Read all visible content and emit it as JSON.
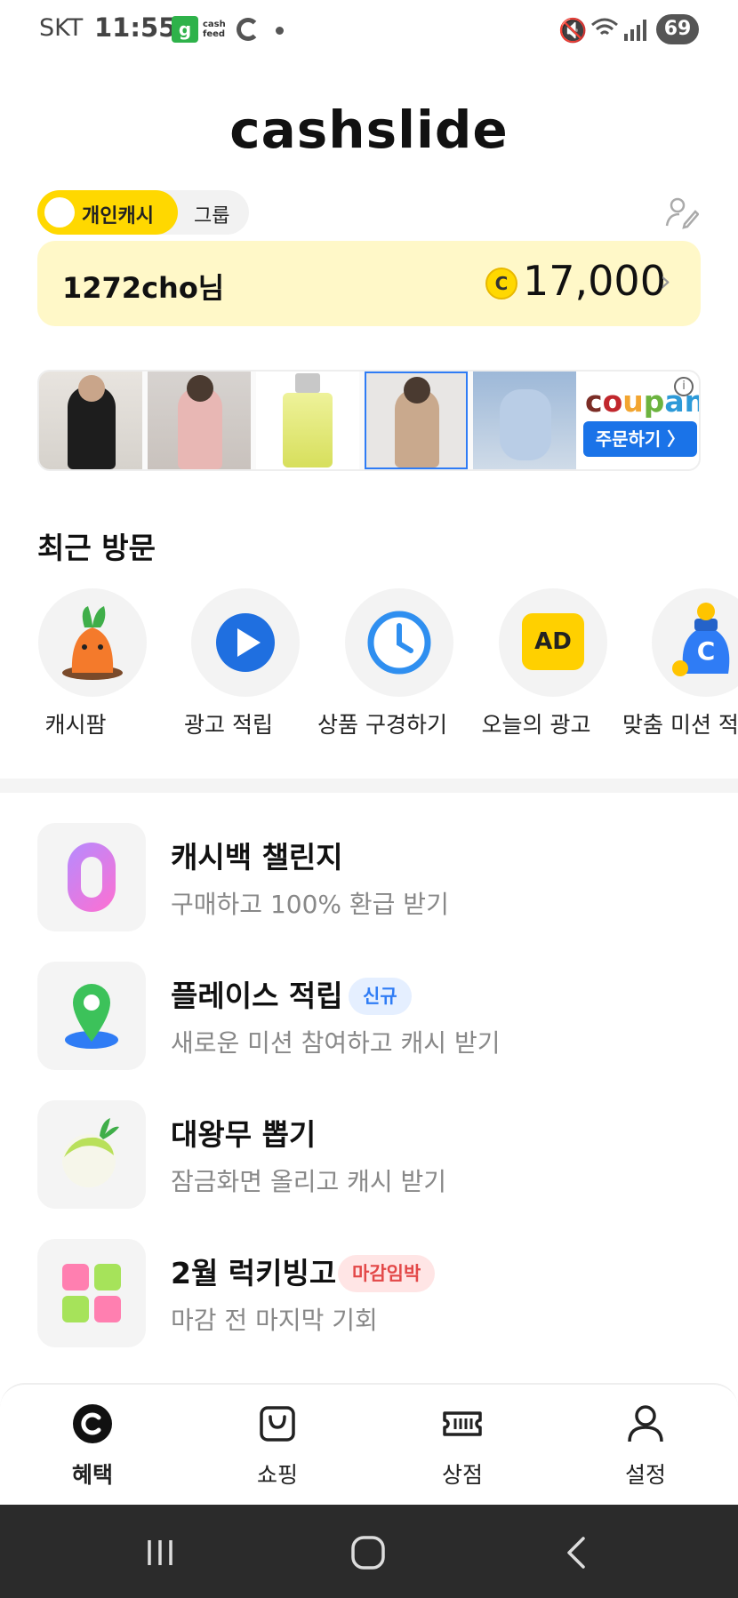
{
  "status_bar": {
    "carrier": "SKT",
    "time": "11:55",
    "notif_g": "g",
    "notif_cashfeed": "cash feed",
    "battery": "69"
  },
  "app": {
    "logo": "cashslide"
  },
  "toggle": {
    "personal": "개인캐시",
    "group": "그룹"
  },
  "points": {
    "user": "1272cho님",
    "coin_symbol": "C",
    "amount": "17,000",
    "chevron": "›"
  },
  "banner": {
    "brand": "coupang",
    "cta": "주문하기 〉",
    "info": "i"
  },
  "recent": {
    "title": "최근 방문",
    "items": [
      {
        "label": "캐시팜",
        "icon": "carrot-icon"
      },
      {
        "label": "광고 적립",
        "icon": "play-icon"
      },
      {
        "label": "상품 구경하기",
        "icon": "clock-icon"
      },
      {
        "label": "오늘의 광고",
        "icon": "ad-icon",
        "icon_text": "AD"
      },
      {
        "label": "맞춤 미션 적",
        "icon": "coin-bag-icon"
      }
    ]
  },
  "features": [
    {
      "title": "캐시백 챌린지",
      "subtitle": "구매하고 100% 환급 받기",
      "icon": "zero-icon",
      "icon_text": "0"
    },
    {
      "title": "플레이스 적립",
      "subtitle": "새로운 미션 참여하고 캐시 받기",
      "badge": "신규",
      "icon": "map-pin-icon"
    },
    {
      "title": "대왕무 뽑기",
      "subtitle": "잠금화면 올리고 캐시 받기",
      "icon": "radish-icon"
    },
    {
      "title": "2월 럭키빙고",
      "subtitle": "마감 전 마지막 기회",
      "badge": "마감임박",
      "icon": "bingo-grid-icon"
    }
  ],
  "bottom_nav": [
    {
      "label": "혜택",
      "icon": "cash-c-icon",
      "active": true
    },
    {
      "label": "쇼핑",
      "icon": "shopping-bag-icon"
    },
    {
      "label": "상점",
      "icon": "ticket-icon"
    },
    {
      "label": "설정",
      "icon": "person-icon"
    }
  ],
  "colors": {
    "accent": "#ffd800",
    "points_bg": "#fff8c8",
    "new_badge": "#2f7cf5",
    "deadline_badge": "#e34848"
  }
}
